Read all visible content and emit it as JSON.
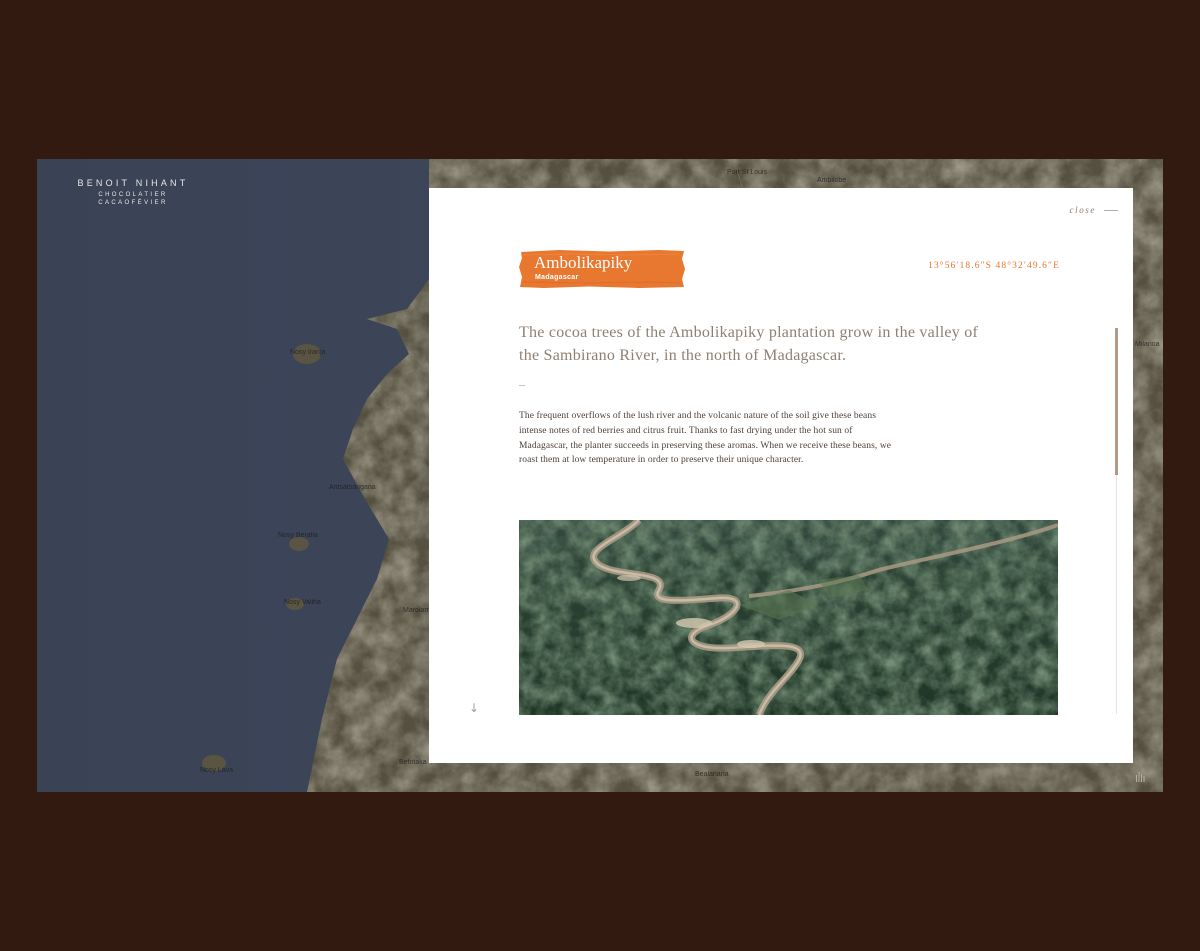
{
  "brand": {
    "name": "BENOIT NIHANT",
    "tagline_1": "CHOCOLATIER",
    "tagline_2": "CACAOFÉVIER"
  },
  "map": {
    "labels": [
      "Nosy Iranja",
      "Antsatsangana",
      "Nosy Berafia",
      "Nosy Valiha",
      "Marolambo",
      "Nosy Lava",
      "Befotaka",
      "Bealanana",
      "Ambilobe",
      "Port St Louis",
      "Milanoa"
    ],
    "colors": {
      "sea": "#3d4658",
      "land": "#5a5441"
    }
  },
  "panel": {
    "close_label": "close",
    "plantation_name": "Ambolikapiky",
    "country": "Madagascar",
    "coordinates": "13°56′18.6″S 48°32′49.6″E",
    "intro": "The cocoa trees of the Ambolikapiky plantation grow in the valley of the Sambirano River, in the north of Madagascar.",
    "separator": "–",
    "body": "The frequent overflows of the lush river and the volcanic nature of the soil give these beans intense notes of red berries and citrus fruit. Thanks to fast drying under the hot sun of Madagascar, the planter succeeds in preserving these aromas. When we receive these beans, we roast them at low temperature in order to preserve their unique character.",
    "scroll_hint": "↓",
    "accent_color": "#e8772f"
  },
  "icons": [
    "close-icon",
    "arrow-down-icon",
    "sound-icon"
  ]
}
